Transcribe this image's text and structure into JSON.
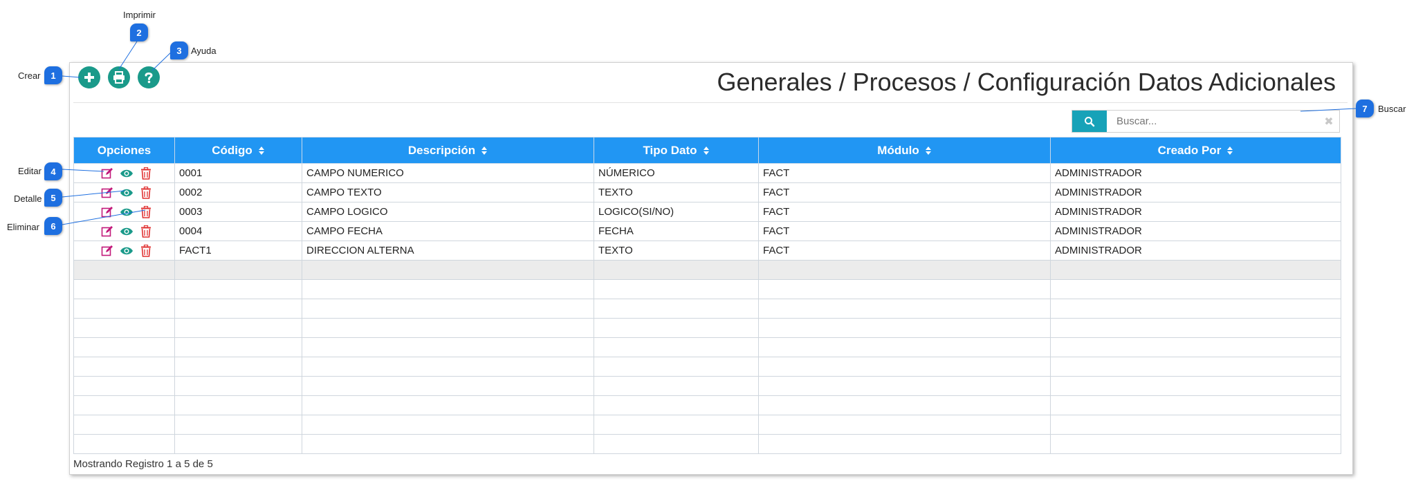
{
  "header": {
    "title": "Generales / Procesos / Configuración Datos Adicionales"
  },
  "toolbar": {
    "create_icon": "plus-circle-icon",
    "print_icon": "printer-icon",
    "help_icon": "question-circle-icon",
    "accent_color": "#1a9a8a"
  },
  "annotations": [
    {
      "number": "1",
      "label": "Crear"
    },
    {
      "number": "2",
      "label": "Imprimir"
    },
    {
      "number": "3",
      "label": "Ayuda"
    },
    {
      "number": "4",
      "label": "Editar"
    },
    {
      "number": "5",
      "label": "Detalle"
    },
    {
      "number": "6",
      "label": "Eliminar"
    },
    {
      "number": "7",
      "label": "Buscar"
    }
  ],
  "search": {
    "placeholder": "Buscar...",
    "value": "",
    "icon": "search-icon",
    "clear_icon": "close-icon",
    "button_color": "#17a2b8"
  },
  "table": {
    "header_color": "#2196f3",
    "columns": [
      "Opciones",
      "Código",
      "Descripción",
      "Tipo Dato",
      "Módulo",
      "Creado Por"
    ],
    "sortable": [
      false,
      true,
      true,
      true,
      true,
      true
    ],
    "row_icons": {
      "edit": "edit-icon",
      "view": "eye-icon",
      "delete": "trash-icon"
    },
    "rows": [
      [
        "0001",
        "CAMPO NUMERICO",
        "NÚMERICO",
        "FACT",
        "ADMINISTRADOR"
      ],
      [
        "0002",
        "CAMPO TEXTO",
        "TEXTO",
        "FACT",
        "ADMINISTRADOR"
      ],
      [
        "0003",
        "CAMPO LOGICO",
        "LOGICO(SI/NO)",
        "FACT",
        "ADMINISTRADOR"
      ],
      [
        "0004",
        "CAMPO FECHA",
        "FECHA",
        "FACT",
        "ADMINISTRADOR"
      ],
      [
        "FACT1",
        "DIRECCION ALTERNA",
        "TEXTO",
        "FACT",
        "ADMINISTRADOR"
      ]
    ],
    "empty_rows": 10
  },
  "footer": {
    "info": "Mostrando Registro 1 a 5 de 5"
  }
}
